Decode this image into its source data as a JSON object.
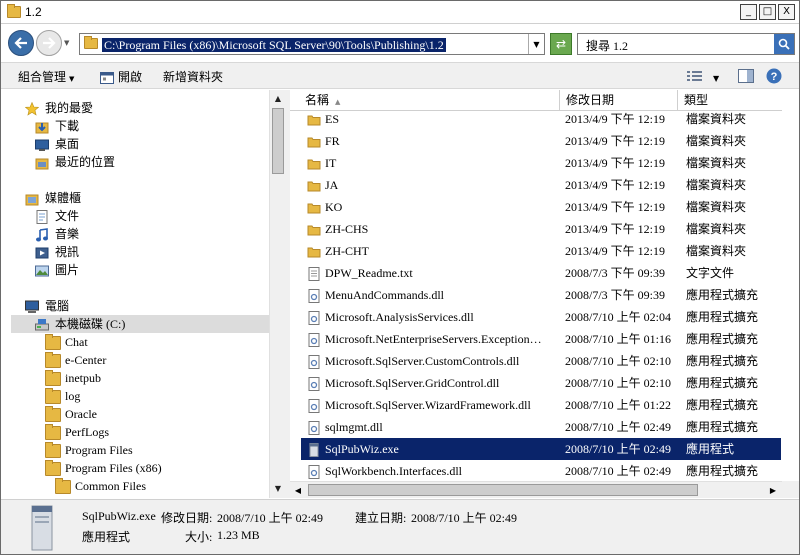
{
  "window": {
    "title": "1.2"
  },
  "title_buttons": {
    "minimize": "_",
    "maximize": "□",
    "close": "X"
  },
  "address": {
    "path": "C:\\Program Files (x86)\\Microsoft SQL Server\\90\\Tools\\Publishing\\1.2"
  },
  "search": {
    "placeholder": "搜尋 1.2"
  },
  "toolbar": {
    "organize": "組合管理",
    "open": "開啟",
    "new_folder": "新增資料夾"
  },
  "nav": {
    "favorites": "我的最愛",
    "favorites_items": [
      "下載",
      "桌面",
      "最近的位置"
    ],
    "libraries": "媒體櫃",
    "library_items": [
      "文件",
      "音樂",
      "視訊",
      "圖片"
    ],
    "computer": "電腦",
    "drive": "本機磁碟 (C:)",
    "folders": [
      "Chat",
      "e-Center",
      "inetpub",
      "log",
      "Oracle",
      "PerfLogs",
      "Program Files",
      "Program Files (x86)",
      "Common Files"
    ]
  },
  "columns": {
    "name": "名稱",
    "date": "修改日期",
    "type": "類型"
  },
  "files": [
    {
      "name": "ES",
      "date": "2013/4/9 下午 12:19",
      "type": "檔案資料夾",
      "icon": "folder-icon"
    },
    {
      "name": "FR",
      "date": "2013/4/9 下午 12:19",
      "type": "檔案資料夾",
      "icon": "folder-icon"
    },
    {
      "name": "IT",
      "date": "2013/4/9 下午 12:19",
      "type": "檔案資料夾",
      "icon": "folder-icon"
    },
    {
      "name": "JA",
      "date": "2013/4/9 下午 12:19",
      "type": "檔案資料夾",
      "icon": "folder-icon"
    },
    {
      "name": "KO",
      "date": "2013/4/9 下午 12:19",
      "type": "檔案資料夾",
      "icon": "folder-icon"
    },
    {
      "name": "ZH-CHS",
      "date": "2013/4/9 下午 12:19",
      "type": "檔案資料夾",
      "icon": "folder-icon"
    },
    {
      "name": "ZH-CHT",
      "date": "2013/4/9 下午 12:19",
      "type": "檔案資料夾",
      "icon": "folder-icon"
    },
    {
      "name": "DPW_Readme.txt",
      "date": "2008/7/3 下午 09:39",
      "type": "文字文件",
      "icon": "text-file-icon"
    },
    {
      "name": "MenuAndCommands.dll",
      "date": "2008/7/3 下午 09:39",
      "type": "應用程式擴充",
      "icon": "dll-file-icon"
    },
    {
      "name": "Microsoft.AnalysisServices.dll",
      "date": "2008/7/10 上午 02:04",
      "type": "應用程式擴充",
      "icon": "dll-file-icon"
    },
    {
      "name": "Microsoft.NetEnterpriseServers.ExceptionMes...",
      "date": "2008/7/10 上午 01:16",
      "type": "應用程式擴充",
      "icon": "dll-file-icon"
    },
    {
      "name": "Microsoft.SqlServer.CustomControls.dll",
      "date": "2008/7/10 上午 02:10",
      "type": "應用程式擴充",
      "icon": "dll-file-icon"
    },
    {
      "name": "Microsoft.SqlServer.GridControl.dll",
      "date": "2008/7/10 上午 02:10",
      "type": "應用程式擴充",
      "icon": "dll-file-icon"
    },
    {
      "name": "Microsoft.SqlServer.WizardFramework.dll",
      "date": "2008/7/10 上午 01:22",
      "type": "應用程式擴充",
      "icon": "dll-file-icon"
    },
    {
      "name": "sqlmgmt.dll",
      "date": "2008/7/10 上午 02:49",
      "type": "應用程式擴充",
      "icon": "dll-file-icon"
    },
    {
      "name": "SqlPubWiz.exe",
      "date": "2008/7/10 上午 02:49",
      "type": "應用程式",
      "icon": "exe-file-icon",
      "selected": true
    },
    {
      "name": "SqlWorkbench.Interfaces.dll",
      "date": "2008/7/10 上午 02:49",
      "type": "應用程式擴充",
      "icon": "dll-file-icon"
    }
  ],
  "details": {
    "filename": "SqlPubWiz.exe",
    "modified_label": "修改日期:",
    "modified": "2008/7/10 上午 02:49",
    "created_label": "建立日期:",
    "created": "2008/7/10 上午 02:49",
    "type": "應用程式",
    "size_label": "大小:",
    "size": "1.23 MB"
  },
  "colors": {
    "selection": "#0a246a",
    "toolbar_bg": "#f0f0f0",
    "folder": "#e6b843"
  }
}
